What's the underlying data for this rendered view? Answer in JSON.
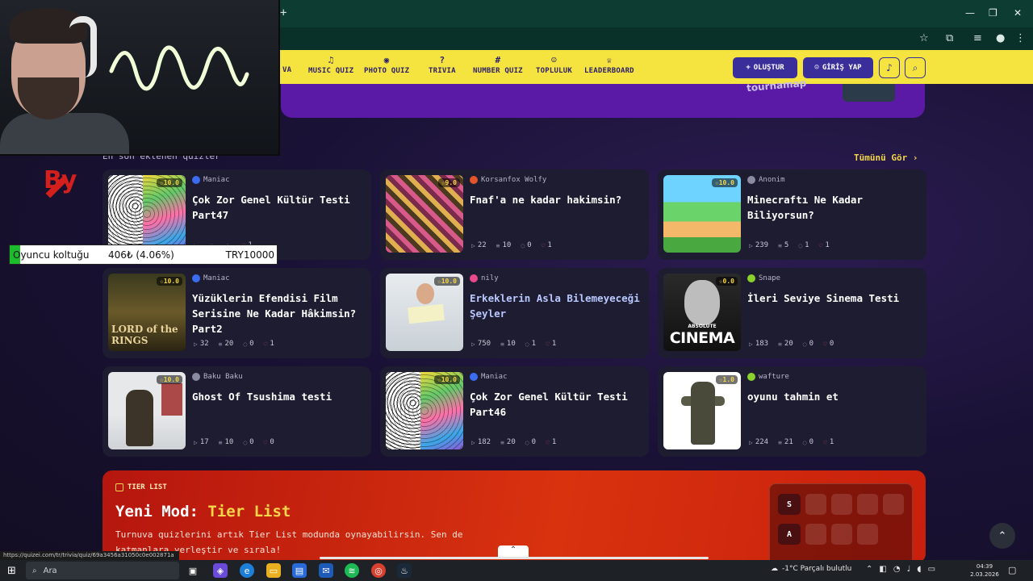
{
  "nav": {
    "partial_label": "VA",
    "items": [
      {
        "label": "MUSIC QUIZ",
        "icon": "music-note-icon",
        "glyph": "♫"
      },
      {
        "label": "PHOTO QUIZ",
        "icon": "camera-icon",
        "glyph": "◉"
      },
      {
        "label": "TRIVIA",
        "icon": "question-icon",
        "glyph": "?"
      },
      {
        "label": "NUMBER QUIZ",
        "icon": "hash-icon",
        "glyph": "#"
      },
      {
        "label": "TOPLULUK",
        "icon": "user-icon",
        "glyph": "☺"
      },
      {
        "label": "LEADERBOARD",
        "icon": "trophy-icon",
        "glyph": "♕"
      }
    ],
    "create_label": "OLUŞTUR",
    "login_label": "GİRİŞ YAP"
  },
  "banner": {
    "logo_text": "tournamap"
  },
  "section": {
    "title": "En son eklenen quizler",
    "see_all": "Tümünü Gör ›"
  },
  "cards": [
    {
      "title": "Çok Zor Genel Kültür Testi Part47",
      "author": "Maniac",
      "score": "☆10.0",
      "stats": [
        "",
        "",
        "",
        "1"
      ],
      "thumb": "brain",
      "avatar_color": "#3b6cf0"
    },
    {
      "title": "Fnaf'a ne kadar hakimsin?",
      "author": "Korsanfox Wolfy",
      "score": "☆9.0",
      "stats": [
        "22",
        "10",
        "0",
        "1"
      ],
      "thumb": "fnaf",
      "avatar_color": "#e2552c"
    },
    {
      "title": "Minecraftı Ne Kadar Biliyorsun?",
      "author": "Anonim",
      "score": "☆10.0",
      "stats": [
        "239",
        "5",
        "1",
        "1"
      ],
      "thumb": "mc",
      "avatar_color": "#8a8aa0"
    },
    {
      "title": "Yüzüklerin Efendisi Film Serisine Ne Kadar Hâkimsin? Part2",
      "author": "Maniac",
      "score": "☆10.0",
      "stats": [
        "32",
        "20",
        "0",
        "1"
      ],
      "thumb": "lotr",
      "avatar_color": "#3b6cf0"
    },
    {
      "title": "Erkeklerin Asla Bilemeyeceği Şeyler",
      "author": "nily",
      "score": "☆10.0",
      "stats": [
        "750",
        "10",
        "1",
        "1"
      ],
      "thumb": "man",
      "avatar_color": "#e84a8c"
    },
    {
      "title": "İleri Seviye Sinema Testi",
      "author": "Snape",
      "score": "☆0.0",
      "stats": [
        "183",
        "20",
        "0",
        "0"
      ],
      "thumb": "cinema",
      "avatar_color": "#8ad12e"
    },
    {
      "title": "Ghost Of Tsushima testi",
      "author": "Baku Baku",
      "score": "☆10.0",
      "stats": [
        "17",
        "10",
        "0",
        "0"
      ],
      "thumb": "ghost",
      "avatar_color": "#8a8aa0"
    },
    {
      "title": "Çok Zor Genel Kültür Testi Part46",
      "author": "Maniac",
      "score": "☆10.0",
      "stats": [
        "182",
        "20",
        "0",
        "1"
      ],
      "thumb": "brain",
      "avatar_color": "#3b6cf0"
    },
    {
      "title": "oyunu tahmin et",
      "author": "wafture",
      "score": "☆1.0",
      "stats": [
        "224",
        "21",
        "0",
        "1"
      ],
      "thumb": "soldier",
      "avatar_color": "#8ad12e"
    }
  ],
  "cinema_thumb": {
    "line1": "ABSOLUTE",
    "line2": "CINEMA"
  },
  "lotr_thumb": {
    "text": "LORD of the RINGS"
  },
  "tier": {
    "tag": "TIER LIST",
    "title_prefix": "Yeni Mod:",
    "title_highlight": "Tier List",
    "description": "Turnuva quizlerini artık Tier List modunda oynayabilirsin. Sen de katmanlara yerleştir ve sırala!",
    "rows": [
      "S",
      "A"
    ]
  },
  "overlay": {
    "by_text": "By",
    "donation_label": "Oyuncu koltuğu",
    "donation_amount": "406₺ (4.06%)",
    "donation_goal": "TRY10000",
    "donation_progress": 0.0406
  },
  "status_url": "https://quizei.com/tr/trivia/quiz/69a3456a31050c0e002871a",
  "taskbar": {
    "search_placeholder": "Ara",
    "weather": "-1°C  Parçalı bulutlu",
    "time": "04:39",
    "date": "2.03.2026"
  },
  "colors": {
    "nav_bg": "#f5e33f",
    "accent": "#3a2f9a",
    "highlight": "#f3d64a",
    "tier_bg": "#d8320f"
  }
}
